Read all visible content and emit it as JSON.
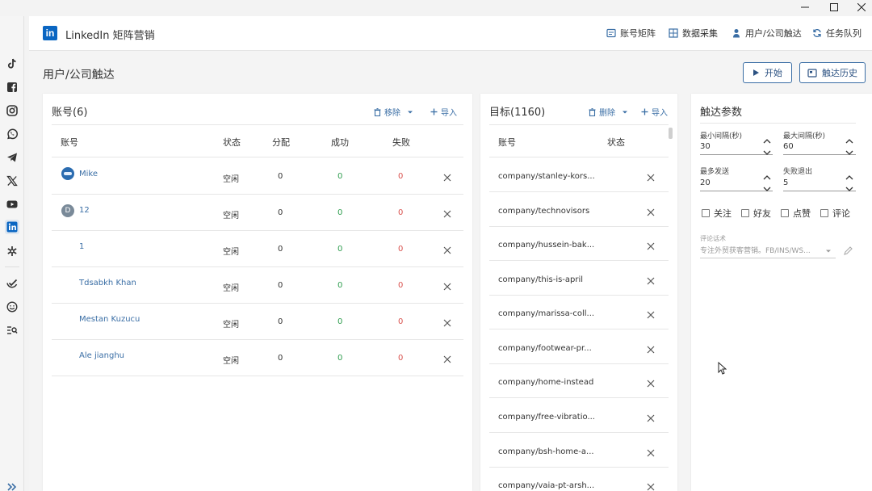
{
  "app": {
    "brand_logo": "in",
    "brand_title": "LinkedIn 矩阵营销",
    "nav": [
      "账号矩阵",
      "数据采集",
      "用户/公司触达",
      "任务队列"
    ]
  },
  "page": {
    "title": "用户/公司触达",
    "start_label": "开始",
    "history_label": "触达历史"
  },
  "accounts": {
    "title": "账号(6)",
    "remove_label": "移除",
    "import_label": "导入",
    "columns": [
      "账号",
      "状态",
      "分配",
      "成功",
      "失败"
    ],
    "rows": [
      {
        "name": "Mike",
        "avatar": "avatar-image",
        "status": "空闲",
        "assigned": "0",
        "success": "0",
        "fail": "0"
      },
      {
        "name": "12",
        "avatar": "D",
        "status": "空闲",
        "assigned": "0",
        "success": "0",
        "fail": "0"
      },
      {
        "name": "1",
        "avatar": "",
        "status": "空闲",
        "assigned": "0",
        "success": "0",
        "fail": "0"
      },
      {
        "name": "Tdsabkh Khan",
        "avatar": "",
        "status": "空闲",
        "assigned": "0",
        "success": "0",
        "fail": "0"
      },
      {
        "name": "Mestan Kuzucu",
        "avatar": "",
        "status": "空闲",
        "assigned": "0",
        "success": "0",
        "fail": "0"
      },
      {
        "name": "Ale jianghu",
        "avatar": "",
        "status": "空闲",
        "assigned": "0",
        "success": "0",
        "fail": "0"
      }
    ]
  },
  "targets": {
    "title": "目标(1160)",
    "delete_label": "删除",
    "import_label": "导入",
    "columns": [
      "账号",
      "状态"
    ],
    "rows": [
      "company/stanley-kors...",
      "company/technovisors",
      "company/hussein-bak...",
      "company/this-is-april",
      "company/marissa-coll...",
      "company/footwear-pr...",
      "company/home-instead",
      "company/free-vibratio...",
      "company/bsh-home-a...",
      "company/vaia-pt-arsh..."
    ]
  },
  "params": {
    "title": "触达参数",
    "min_interval_label": "最小间隔(秒)",
    "min_interval": "30",
    "max_interval_label": "最大间隔(秒)",
    "max_interval": "60",
    "max_send_label": "最多发送",
    "max_send": "20",
    "fail_exit_label": "失败退出",
    "fail_exit": "5",
    "options": [
      "关注",
      "好友",
      "点赞",
      "评论"
    ],
    "comment_label": "评论话术",
    "comment_value": "专注外贸获客营销。FB/INS/WS..."
  },
  "colors": {
    "accent": "#3a6ea5",
    "brand": "#0a66c2",
    "success": "#2e9d4e",
    "fail": "#d9534f"
  }
}
